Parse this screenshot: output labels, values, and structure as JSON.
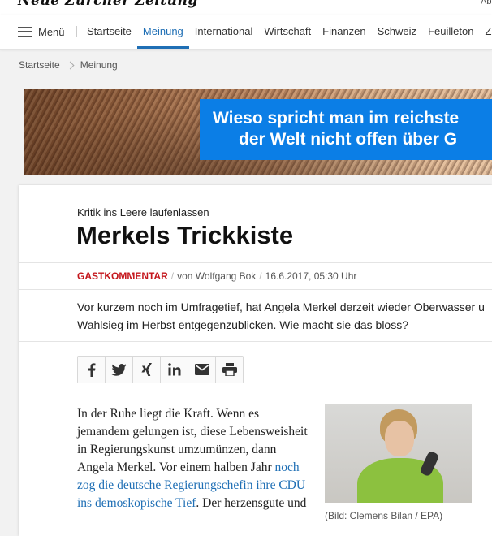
{
  "header": {
    "logo_text": "Neue Zürcher Zeitung",
    "top_right": "Ab"
  },
  "nav": {
    "menu_label": "Menü",
    "items": [
      "Startseite",
      "Meinung",
      "International",
      "Wirtschaft",
      "Finanzen",
      "Schweiz",
      "Feuilleton",
      "Züri"
    ],
    "active": "Meinung"
  },
  "breadcrumb": {
    "items": [
      "Startseite",
      "Meinung"
    ]
  },
  "banner": {
    "line1": "Wieso spricht man im reichste",
    "line2": "der Welt nicht offen über G"
  },
  "article": {
    "kicker": "Kritik ins Leere laufenlassen",
    "title": "Merkels Trickkiste",
    "category": "GASTKOMMENTAR",
    "author": "von Wolfgang Bok",
    "date": "16.6.2017, 05:30 Uhr",
    "lead_line1": "Vor kurzem noch im Umfragetief, hat Angela Merkel derzeit wieder Oberwasser u",
    "lead_line2": "Wahlsieg im Herbst entgegenzublicken. Wie macht sie das bloss?",
    "body_text1": "In der Ruhe liegt die Kraft. Wenn es jemandem gelungen ist, diese Lebensweisheit in Regierungskunst umzumünzen, dann Angela Merkel. Vor einem halben Jahr ",
    "body_link": "noch zog die deutsche Regierungschefin ihre CDU ins demoskopische Tief",
    "body_text2": ". Der herzensgute und",
    "image_caption": "(Bild: Clemens Bilan / EPA)"
  },
  "share": {
    "icons": [
      "facebook-icon",
      "twitter-icon",
      "xing-icon",
      "linkedin-icon",
      "mail-icon",
      "print-icon"
    ]
  },
  "colors": {
    "accent": "#1f6fb5",
    "category": "#c4161c",
    "banner_box": "#0b7ee6"
  }
}
